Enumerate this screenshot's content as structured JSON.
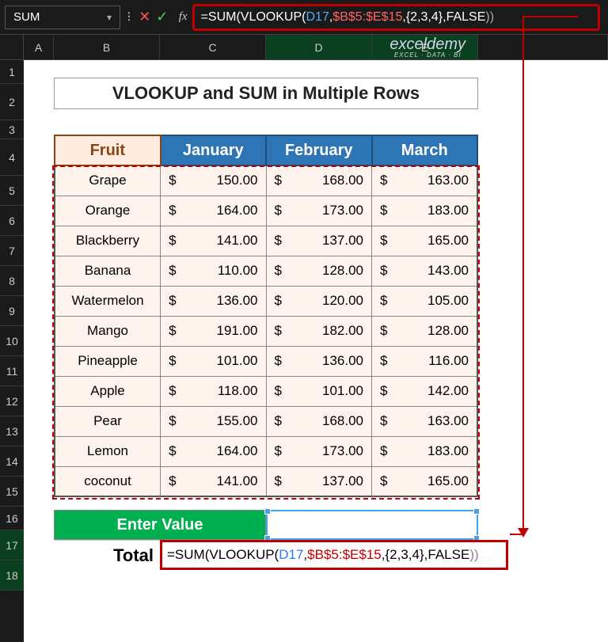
{
  "name_box": {
    "value": "SUM"
  },
  "formula": {
    "prefix": "=SUM(VLOOKUP(",
    "cell_ref": "D17",
    "sep1": ", ",
    "range_ref": "$B$5:$E$15",
    "sep2": ", ",
    "cols": "{2,3,4}",
    "sep3": ", ",
    "falseval": "FALSE",
    "close": "))"
  },
  "columns": [
    "A",
    "B",
    "C",
    "D",
    "E"
  ],
  "rows": [
    1,
    2,
    3,
    4,
    5,
    6,
    7,
    8,
    9,
    10,
    11,
    12,
    13,
    14,
    15,
    16,
    17,
    18
  ],
  "title": "VLOOKUP and SUM in Multiple Rows",
  "headers": {
    "fruit": "Fruit",
    "m1": "January",
    "m2": "February",
    "m3": "March"
  },
  "data": [
    {
      "fruit": "Grape",
      "m1": "150.00",
      "m2": "168.00",
      "m3": "163.00"
    },
    {
      "fruit": "Orange",
      "m1": "164.00",
      "m2": "173.00",
      "m3": "183.00"
    },
    {
      "fruit": "Blackberry",
      "m1": "141.00",
      "m2": "137.00",
      "m3": "165.00"
    },
    {
      "fruit": "Banana",
      "m1": "110.00",
      "m2": "128.00",
      "m3": "143.00"
    },
    {
      "fruit": "Watermelon",
      "m1": "136.00",
      "m2": "120.00",
      "m3": "105.00"
    },
    {
      "fruit": "Mango",
      "m1": "191.00",
      "m2": "182.00",
      "m3": "128.00"
    },
    {
      "fruit": "Pineapple",
      "m1": "101.00",
      "m2": "136.00",
      "m3": "116.00"
    },
    {
      "fruit": "Apple",
      "m1": "118.00",
      "m2": "101.00",
      "m3": "142.00"
    },
    {
      "fruit": "Pear",
      "m1": "155.00",
      "m2": "168.00",
      "m3": "163.00"
    },
    {
      "fruit": "Lemon",
      "m1": "164.00",
      "m2": "173.00",
      "m3": "183.00"
    },
    {
      "fruit": "coconut",
      "m1": "141.00",
      "m2": "137.00",
      "m3": "165.00"
    }
  ],
  "enter_label": "Enter Value",
  "total_label": "Total",
  "watermark": {
    "brand": "exceldemy",
    "tag": "EXCEL · DATA · BI"
  },
  "cellformula": {
    "prefix": "=SUM(VLOOKUP(",
    "cell_ref": "D17",
    "sep1": ", ",
    "range_ref": "$B$5:$E$15",
    "sep2": ", ",
    "cols": "{2,3,4}",
    "sep3": ", ",
    "falseval": "FALSE",
    "close": "))"
  }
}
